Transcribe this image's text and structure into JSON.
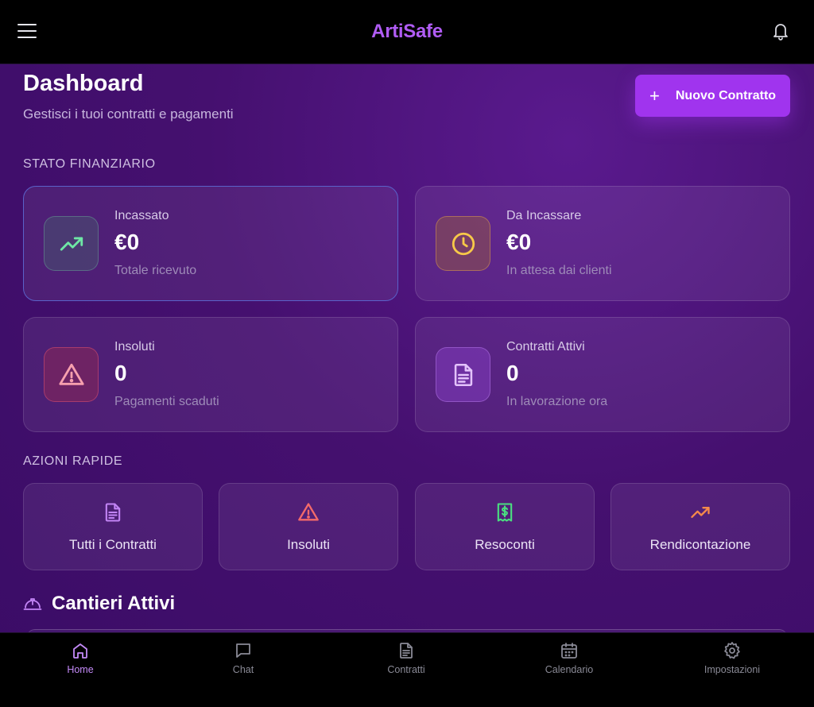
{
  "topbar": {
    "brand": "ArtiSafe",
    "menu_icon": "hamburger-menu-icon",
    "notification_icon": "bell-icon"
  },
  "header": {
    "title": "Dashboard",
    "subtitle": "Gestisci i tuoi contratti e pagamenti",
    "new_button_label": "Nuovo Contratto",
    "new_button_icon": "plus-icon"
  },
  "financial": {
    "section_label": "STATO FINANZIARIO",
    "cards": [
      {
        "title": "Incassato",
        "value": "€0",
        "subtitle": "Totale ricevuto",
        "icon": "trending-up-icon",
        "color": "#6ee7a5"
      },
      {
        "title": "Da Incassare",
        "value": "€0",
        "subtitle": "In attesa dai clienti",
        "icon": "clock-icon",
        "color": "#f7c948"
      },
      {
        "title": "Insoluti",
        "value": "0",
        "subtitle": "Pagamenti scaduti",
        "icon": "warning-triangle-icon",
        "color": "#f47a8e"
      },
      {
        "title": "Contratti Attivi",
        "value": "0",
        "subtitle": "In lavorazione ora",
        "icon": "document-icon",
        "color": "#d59cf8"
      }
    ]
  },
  "quick_actions": {
    "section_label": "AZIONI RAPIDE",
    "items": [
      {
        "label": "Tutti i Contratti",
        "icon": "document-icon",
        "color": "#c284f5"
      },
      {
        "label": "Insoluti",
        "icon": "warning-triangle-icon",
        "color": "#f46a6a"
      },
      {
        "label": "Resoconti",
        "icon": "receipt-dollar-icon",
        "color": "#4ade80"
      },
      {
        "label": "Rendicontazione",
        "icon": "trending-up-icon",
        "color": "#f58a4a"
      }
    ]
  },
  "cantieri": {
    "title": "Cantieri Attivi",
    "icon": "hard-hat-icon"
  },
  "bottom_nav": {
    "items": [
      {
        "label": "Home",
        "icon": "home-icon",
        "active": true
      },
      {
        "label": "Chat",
        "icon": "chat-bubble-icon",
        "active": false
      },
      {
        "label": "Contratti",
        "icon": "document-icon",
        "active": false
      },
      {
        "label": "Calendario",
        "icon": "calendar-icon",
        "active": false
      },
      {
        "label": "Impostazioni",
        "icon": "gear-icon",
        "active": false
      }
    ]
  },
  "colors": {
    "accent": "#a034ee",
    "brand": "#b05cf4",
    "active_nav": "#c48af8"
  }
}
